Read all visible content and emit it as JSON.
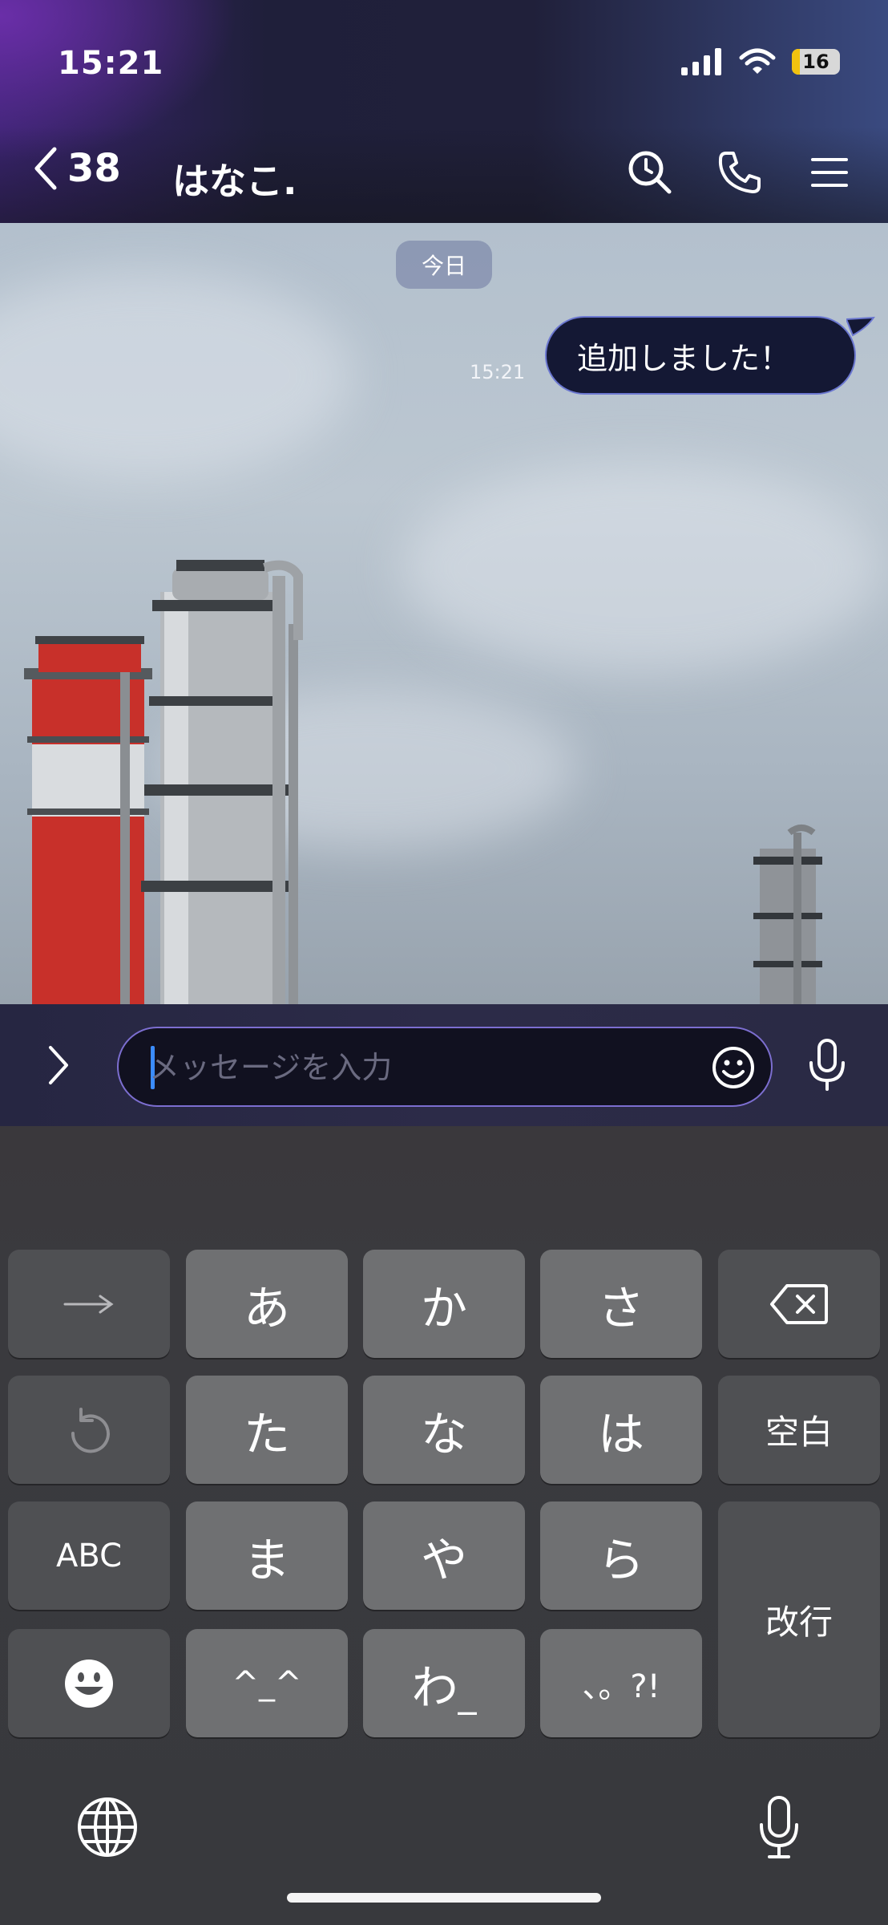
{
  "status_bar": {
    "time": "15:21",
    "battery": "16",
    "battery_level": 0.16
  },
  "header": {
    "back_count": "38",
    "title": "はなこ."
  },
  "chat": {
    "date_label": "今日",
    "messages": [
      {
        "text": "追加しました！",
        "time": "15:21",
        "sender": "self"
      }
    ]
  },
  "input": {
    "placeholder": "メッセージを入力"
  },
  "keyboard": {
    "rows": [
      [
        "→",
        "あ",
        "か",
        "さ",
        "⌫"
      ],
      [
        "↺",
        "た",
        "な",
        "は",
        "空白"
      ],
      [
        "ABC",
        "ま",
        "や",
        "ら",
        "改行"
      ],
      [
        "☻",
        "^_^",
        "わ_",
        "、。?!"
      ]
    ],
    "space_label": "空白",
    "return_label": "改行",
    "abc_label": "ABC",
    "face_label": "^_^",
    "wa_label": "わ",
    "punct_label": "、。?!"
  },
  "colors": {
    "bubble_bg": "#141834",
    "bubble_border": "#6b77d0",
    "input_border": "#7c6ed0",
    "cursor": "#3b8cff",
    "key_main": "#6f7072",
    "key_func": "#4f5053"
  },
  "icons": [
    "back-chevron-icon",
    "search-icon",
    "phone-icon",
    "menu-icon",
    "expand-chevron-icon",
    "emoji-icon",
    "mic-icon",
    "globe-icon",
    "delete-icon",
    "undo-icon",
    "emoji-face-icon"
  ]
}
